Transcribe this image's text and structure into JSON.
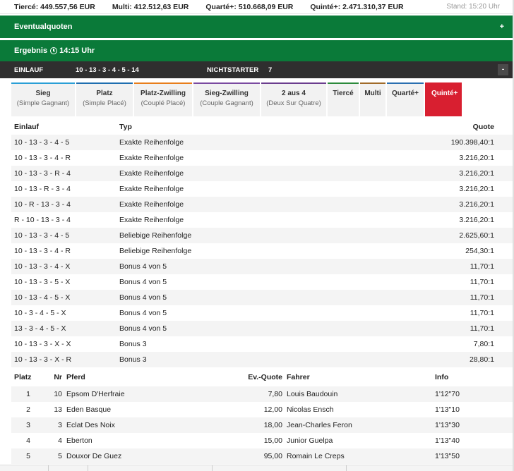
{
  "topbar": {
    "tierce": "Tiercé: 449.557,56 EUR",
    "multi": "Multi: 412.512,63 EUR",
    "quarte": "Quarté+: 510.668,09 EUR",
    "quinte": "Quinté+: 2.471.310,37 EUR",
    "stand": "Stand: 15:20 Uhr"
  },
  "eventual": {
    "title": "Eventualquoten",
    "toggle": "+"
  },
  "ergebnis": {
    "label": "Ergebnis",
    "time": "14:15 Uhr"
  },
  "einlauf_bar": {
    "einlauf_label": "EINLAUF",
    "einlauf_value": "10 - 13 - 3 - 4 - 5 - 14",
    "nichtstarter_label": "NICHTSTARTER",
    "nichtstarter_value": "7",
    "toggle": "-"
  },
  "tabs": [
    {
      "label": "Sieg",
      "sub": "(Simple Gagnant)",
      "color": "#2a9fd6"
    },
    {
      "label": "Platz",
      "sub": "(Simple Placé)",
      "color": "#1f6fb0"
    },
    {
      "label": "Platz-Zwilling",
      "sub": "(Couplé Placé)",
      "color": "#e87e1c"
    },
    {
      "label": "Sieg-Zwilling",
      "sub": "(Couple Gagnant)",
      "color": "#7a4aa0"
    },
    {
      "label": "2 aus 4",
      "sub": "(Deux Sur Quatre)",
      "color": "#6b3d8e"
    },
    {
      "label": "Tiercé",
      "sub": "",
      "color": "#2c8a3c"
    },
    {
      "label": "Multi",
      "sub": "",
      "color": "#a06b2a"
    },
    {
      "label": "Quarté+",
      "sub": "",
      "color": "#2a6fb0"
    },
    {
      "label": "Quinté+",
      "sub": "",
      "color": "#d81f30"
    }
  ],
  "quoten": {
    "headers": {
      "einlauf": "Einlauf",
      "typ": "Typ",
      "quote": "Quote"
    },
    "rows": [
      {
        "einlauf": "10 - 13 - 3 - 4 - 5",
        "typ": "Exakte Reihenfolge",
        "quote": "190.398,40:1"
      },
      {
        "einlauf": "10 - 13 - 3 - 4 - R",
        "typ": "Exakte Reihenfolge",
        "quote": "3.216,20:1"
      },
      {
        "einlauf": "10 - 13 - 3 - R - 4",
        "typ": "Exakte Reihenfolge",
        "quote": "3.216,20:1"
      },
      {
        "einlauf": "10 - 13 - R - 3 - 4",
        "typ": "Exakte Reihenfolge",
        "quote": "3.216,20:1"
      },
      {
        "einlauf": "10 - R - 13 - 3 - 4",
        "typ": "Exakte Reihenfolge",
        "quote": "3.216,20:1"
      },
      {
        "einlauf": "R - 10 - 13 - 3 - 4",
        "typ": "Exakte Reihenfolge",
        "quote": "3.216,20:1"
      },
      {
        "einlauf": "10 - 13 - 3 - 4 - 5",
        "typ": "Beliebige Reihenfolge",
        "quote": "2.625,60:1"
      },
      {
        "einlauf": "10 - 13 - 3 - 4 - R",
        "typ": "Beliebige Reihenfolge",
        "quote": "254,30:1"
      },
      {
        "einlauf": "10 - 13 - 3 - 4 - X",
        "typ": "Bonus 4 von 5",
        "quote": "11,70:1"
      },
      {
        "einlauf": "10 - 13 - 3 - 5 - X",
        "typ": "Bonus 4 von 5",
        "quote": "11,70:1"
      },
      {
        "einlauf": "10 - 13 - 4 - 5 - X",
        "typ": "Bonus 4 von 5",
        "quote": "11,70:1"
      },
      {
        "einlauf": "10 - 3 - 4 - 5 - X",
        "typ": "Bonus 4 von 5",
        "quote": "11,70:1"
      },
      {
        "einlauf": "13 - 3 - 4 - 5 - X",
        "typ": "Bonus 4 von 5",
        "quote": "11,70:1"
      },
      {
        "einlauf": "10 - 13 - 3 - X - X",
        "typ": "Bonus 3",
        "quote": "7,80:1"
      },
      {
        "einlauf": "10 - 13 - 3 - X - R",
        "typ": "Bonus 3",
        "quote": "28,80:1"
      }
    ]
  },
  "results": {
    "headers": {
      "platz": "Platz",
      "nr": "Nr",
      "pferd": "Pferd",
      "evquote": "Ev.-Quote",
      "fahrer": "Fahrer",
      "info": "Info"
    },
    "rows": [
      {
        "platz": "1",
        "nr": "10",
        "pferd": "Epsom D'Herfraie",
        "evquote": "7,80",
        "fahrer": "Louis Baudouin",
        "info": "1'12\"70"
      },
      {
        "platz": "2",
        "nr": "13",
        "pferd": "Eden Basque",
        "evquote": "12,00",
        "fahrer": "Nicolas Ensch",
        "info": "1'13\"10"
      },
      {
        "platz": "3",
        "nr": "3",
        "pferd": "Eclat Des Noix",
        "evquote": "18,00",
        "fahrer": "Jean-Charles Feron",
        "info": "1'13\"30"
      },
      {
        "platz": "4",
        "nr": "4",
        "pferd": "Eberton",
        "evquote": "15,00",
        "fahrer": "Junior Guelpa",
        "info": "1'13\"40"
      },
      {
        "platz": "5",
        "nr": "5",
        "pferd": "Douxor De Guez",
        "evquote": "95,00",
        "fahrer": "Romain Le Creps",
        "info": "1'13\"50"
      }
    ]
  }
}
